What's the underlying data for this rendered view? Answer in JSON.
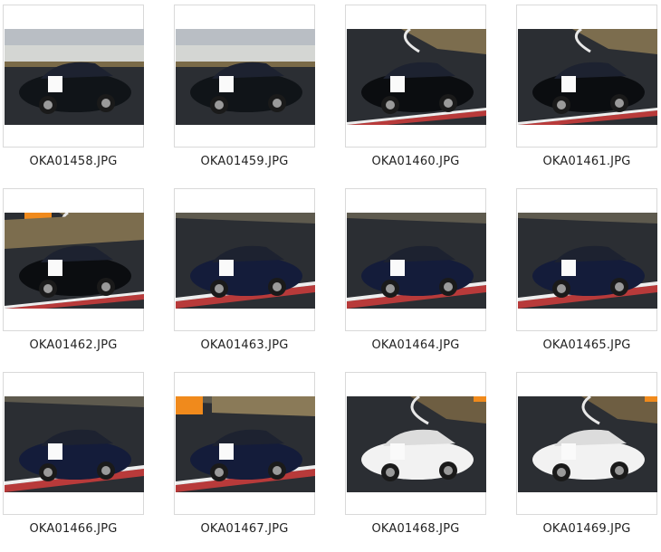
{
  "thumbnails": [
    {
      "filename": "OKA01458.JPG",
      "scene": "hatch",
      "car_color": "#101418"
    },
    {
      "filename": "OKA01459.JPG",
      "scene": "hatch",
      "car_color": "#101418"
    },
    {
      "filename": "OKA01460.JPG",
      "scene": "lotus",
      "car_color": "#0b0d10"
    },
    {
      "filename": "OKA01461.JPG",
      "scene": "lotus",
      "car_color": "#0b0d10"
    },
    {
      "filename": "OKA01462.JPG",
      "scene": "lotus2",
      "car_color": "#0b0d10"
    },
    {
      "filename": "OKA01463.JPG",
      "scene": "porsche",
      "car_color": "#141c3a"
    },
    {
      "filename": "OKA01464.JPG",
      "scene": "porsche",
      "car_color": "#141c3a"
    },
    {
      "filename": "OKA01465.JPG",
      "scene": "porsche",
      "car_color": "#141c3a"
    },
    {
      "filename": "OKA01466.JPG",
      "scene": "porsche2",
      "car_color": "#141c3a"
    },
    {
      "filename": "OKA01467.JPG",
      "scene": "porsche3",
      "car_color": "#141c3a"
    },
    {
      "filename": "OKA01468.JPG",
      "scene": "subaru",
      "car_color": "#f2f2f2"
    },
    {
      "filename": "OKA01469.JPG",
      "scene": "subaru",
      "car_color": "#f2f2f2"
    }
  ]
}
